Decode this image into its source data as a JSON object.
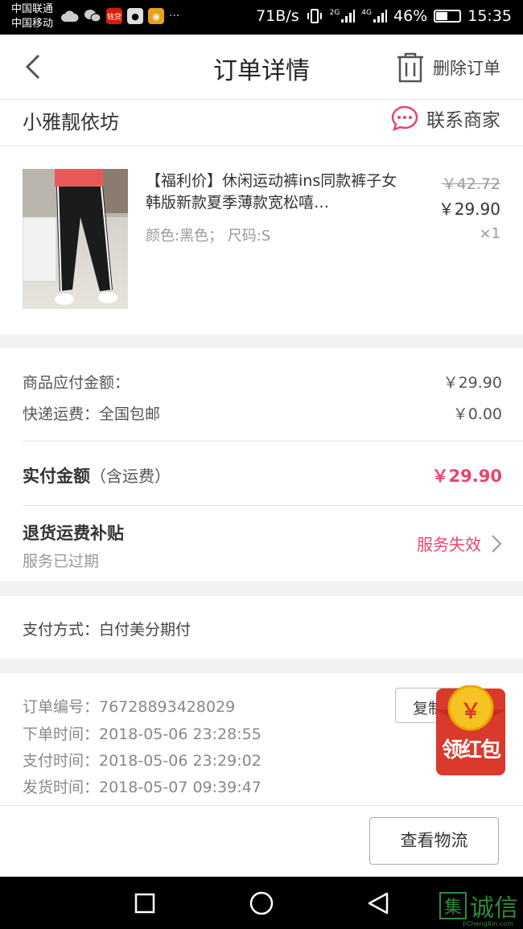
{
  "status_bar": {
    "carrier_1": "中国联通",
    "carrier_2": "中国移动",
    "more": "···",
    "net_speed": "71B/s",
    "net_2g": "2G",
    "net_4g": "4G",
    "battery": "46%",
    "time": "15:35",
    "app_icon_label": "钱贷"
  },
  "header": {
    "title": "订单详情",
    "delete_label": "删除订单"
  },
  "shop": {
    "name": "小雅靓依坊",
    "contact_label": "联系商家"
  },
  "product": {
    "title": "【福利价】休闲运动裤ins同款裤子女韩版新款夏季薄款宽松嘻…",
    "spec": "颜色:黑色； 尺码:S",
    "original_price": "￥42.72",
    "price": "￥29.90",
    "quantity": "×1"
  },
  "fees": {
    "goods_label": "商品应付金额：",
    "goods_value": "￥29.90",
    "shipping_label": "快递运费：全国包邮",
    "shipping_value": "￥0.00",
    "paid_label": "实付金额",
    "paid_suffix": "（含运费）",
    "paid_value": "￥29.90",
    "subsidy_title": "退货运费补贴",
    "subsidy_status": "服务已过期",
    "service_label": "服务失效"
  },
  "payment": {
    "method": "支付方式：白付美分期付"
  },
  "order_info": {
    "number": "订单编号：76728893428029",
    "created": "下单时间：2018-05-06  23:28:55",
    "paid": "支付时间：2018-05-06  23:29:02",
    "shipped": "发货时间：2018-05-07  09:39:47",
    "copy_label": "复制"
  },
  "bottom": {
    "logistics_label": "查看物流"
  },
  "red_packet": {
    "label": "领红包",
    "coin": "￥"
  },
  "watermark": {
    "box_char": "集",
    "text": "诚信",
    "url": "JiChengXin.com"
  },
  "colors": {
    "accent": "#e8456a",
    "red_packet": "#d93a2b"
  }
}
